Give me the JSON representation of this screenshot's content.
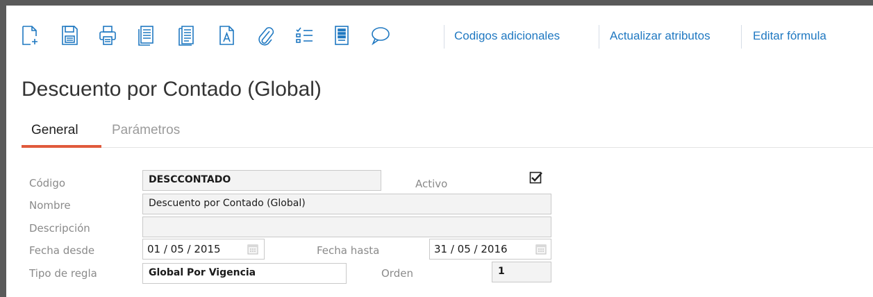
{
  "toolbar": {
    "icons": [
      "new-document-icon",
      "save-icon",
      "print-icon",
      "copy-document-icon",
      "duplicate-document-icon",
      "text-document-icon",
      "attach-icon",
      "checklist-icon",
      "notes-icon",
      "comment-icon"
    ],
    "links": [
      "Codigos adicionales",
      "Actualizar atributos",
      "Editar fórmula"
    ]
  },
  "page": {
    "title": "Descuento por Contado (Global)"
  },
  "tabs": [
    {
      "label": "General",
      "active": true
    },
    {
      "label": "Parámetros",
      "active": false
    }
  ],
  "form": {
    "codigo": {
      "label": "Código",
      "value": "DESCCONTADO"
    },
    "activo": {
      "label": "Activo",
      "checked": true
    },
    "nombre": {
      "label": "Nombre",
      "value": "Descuento por Contado (Global)"
    },
    "descripcion": {
      "label": "Descripción",
      "value": ""
    },
    "fecha_desde": {
      "label": "Fecha desde",
      "value": "01 / 05 / 2015"
    },
    "fecha_hasta": {
      "label": "Fecha hasta",
      "value": "31 / 05 / 2016"
    },
    "tipo_regla": {
      "label": "Tipo de regla",
      "value": "Global Por Vigencia"
    },
    "orden": {
      "label": "Orden",
      "value": "1"
    }
  },
  "colors": {
    "accent": "#1f78c1",
    "tab_underline": "#e05a3c",
    "frame": "#5a5a5a"
  }
}
